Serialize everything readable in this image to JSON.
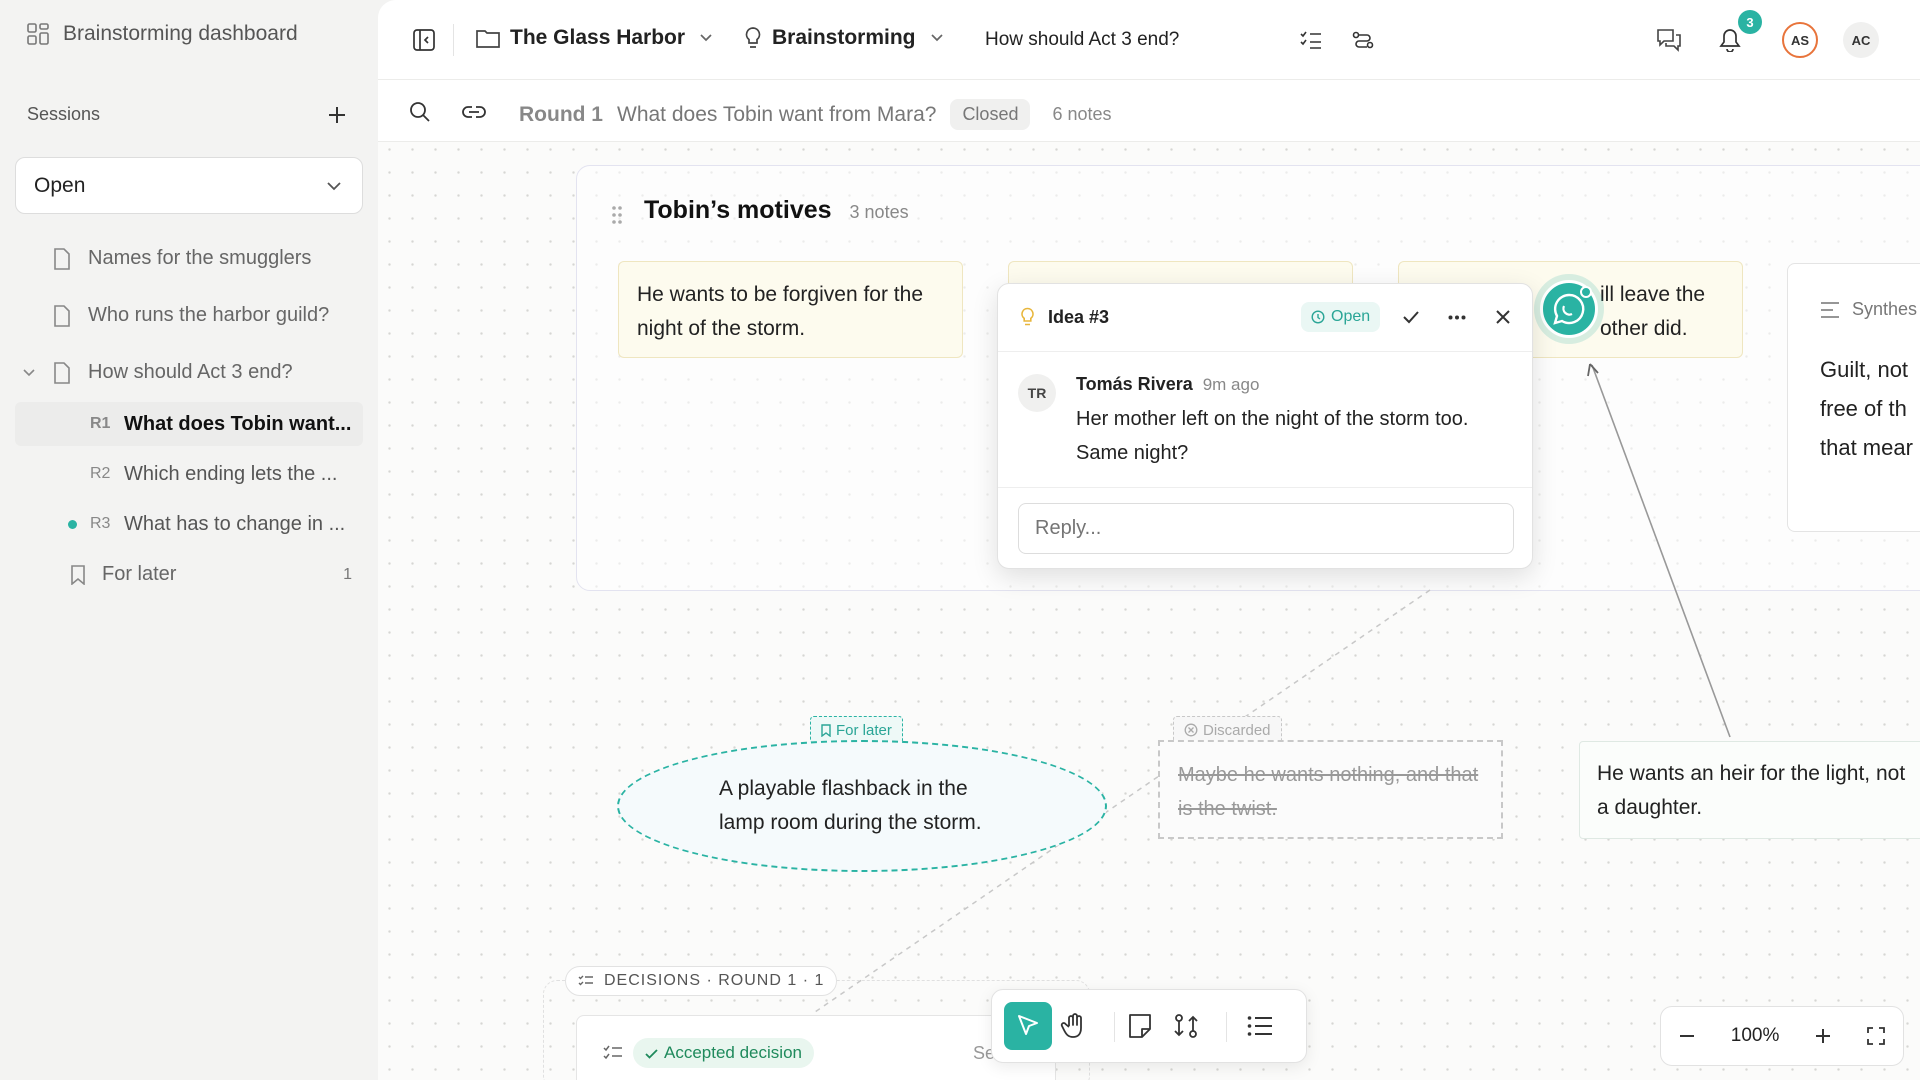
{
  "sidebar": {
    "dashboard_label": "Brainstorming dashboard",
    "sessions_label": "Sessions",
    "filter_value": "Open",
    "sessions": [
      {
        "label": "Names for the smugglers"
      },
      {
        "label": "Who runs the harbor guild?"
      },
      {
        "label": "How should Act 3 end?"
      }
    ],
    "rounds": [
      {
        "code": "R1",
        "label": "What does Tobin want..."
      },
      {
        "code": "R2",
        "label": "Which ending lets the ..."
      },
      {
        "code": "R3",
        "label": "What has to change in ..."
      }
    ],
    "for_later": {
      "label": "For later",
      "count": "1"
    }
  },
  "topbar": {
    "project": "The Glass Harbor",
    "mode": "Brainstorming",
    "session": "How should Act 3 end?",
    "notifications": "3",
    "avatar1": "AS",
    "avatar2": "AC"
  },
  "subbar": {
    "round": "Round 1",
    "question": "What does Tobin want from Mara?",
    "status": "Closed",
    "notes": "6 notes"
  },
  "group": {
    "title": "Tobin’s motives",
    "count": "3 notes",
    "note1": "He wants to be forgiven for the night of the storm.",
    "note3a": "ill leave the",
    "note3b": "other did.",
    "synth_label": "Synthes",
    "synth_lines": [
      "Guilt, not",
      "free of th",
      "that mear"
    ]
  },
  "popover": {
    "title": "Idea #3",
    "status": "Open",
    "author_initials": "TR",
    "author": "Tomás Rivera",
    "time": "9m ago",
    "message": "Her mother left on the night of the storm too. Same night?",
    "reply_placeholder": "Reply..."
  },
  "canvas": {
    "for_later_tag": "For later",
    "flashback": "A playable flashback in the lamp room during the storm.",
    "discarded_tag": "Discarded",
    "discarded_note": "Maybe he wants nothing, and that is the twist.",
    "heir_note": "He wants an heir for the light, not a daughter.",
    "decisions_label": "DECISIONS · ROUND 1 · 1",
    "accepted_label": "Accepted decision",
    "accepted_trailing": "Se"
  },
  "zoom": {
    "level": "100%"
  },
  "colors": {
    "accent": "#2ab3a3",
    "avatar_orange": "#e8743b"
  }
}
